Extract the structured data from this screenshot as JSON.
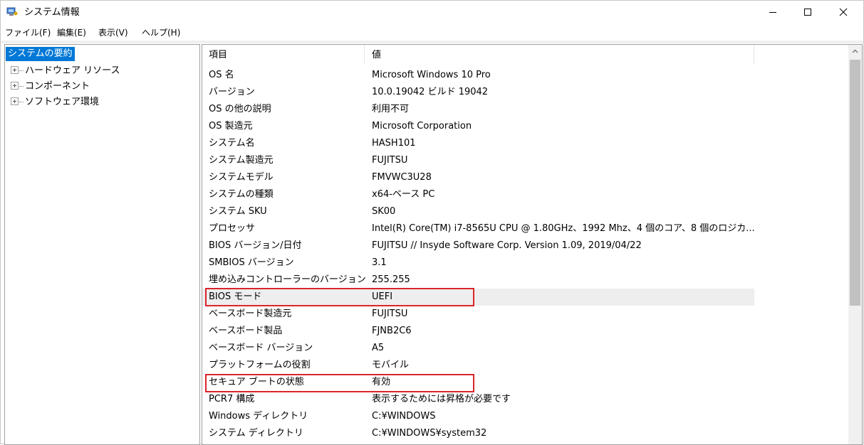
{
  "window": {
    "title": "システム情報",
    "app_icon": "system-info-icon",
    "controls": {
      "minimize": "minimize-icon",
      "maximize": "maximize-icon",
      "close": "close-icon"
    }
  },
  "menu": {
    "items": [
      {
        "label": "ファイル(F)"
      },
      {
        "label": "編集(E)"
      },
      {
        "label": "表示(V)"
      },
      {
        "label": "ヘルプ(H)"
      }
    ]
  },
  "tree": {
    "root": {
      "label": "システムの要約",
      "selected": true
    },
    "children": [
      {
        "label": "ハードウェア リソース",
        "icon": "expand-plus-icon"
      },
      {
        "label": "コンポーネント",
        "icon": "expand-plus-icon"
      },
      {
        "label": "ソフトウェア環境",
        "icon": "expand-plus-icon"
      }
    ]
  },
  "list": {
    "columns": [
      {
        "label": "項目"
      },
      {
        "label": "値"
      }
    ],
    "rows": [
      {
        "item": "OS 名",
        "value": "Microsoft Windows 10 Pro"
      },
      {
        "item": "バージョン",
        "value": "10.0.19042 ビルド 19042"
      },
      {
        "item": "OS の他の説明",
        "value": "利用不可"
      },
      {
        "item": "OS 製造元",
        "value": "Microsoft Corporation"
      },
      {
        "item": "システム名",
        "value": "HASH101"
      },
      {
        "item": "システム製造元",
        "value": "FUJITSU"
      },
      {
        "item": "システムモデル",
        "value": "FMVWC3U28"
      },
      {
        "item": "システムの種類",
        "value": "x64-ベース PC"
      },
      {
        "item": "システム SKU",
        "value": "SK00"
      },
      {
        "item": "プロセッサ",
        "value": "Intel(R) Core(TM) i7-8565U CPU @ 1.80GHz、1992 Mhz、4 個のコア、8 個のロジカ..."
      },
      {
        "item": "BIOS バージョン/日付",
        "value": "FUJITSU // Insyde Software Corp. Version 1.09, 2019/04/22"
      },
      {
        "item": "SMBIOS バージョン",
        "value": "3.1"
      },
      {
        "item": "埋め込みコントローラーのバージョン",
        "value": "255.255"
      },
      {
        "item": "BIOS モード",
        "value": "UEFI",
        "highlighted": true,
        "annotated": true
      },
      {
        "item": "ベースボード製造元",
        "value": "FUJITSU"
      },
      {
        "item": "ベースボード製品",
        "value": "FJNB2C6"
      },
      {
        "item": "ベースボード バージョン",
        "value": "A5"
      },
      {
        "item": "プラットフォームの役割",
        "value": "モバイル"
      },
      {
        "item": "セキュア ブートの状態",
        "value": "有効",
        "annotated": true
      },
      {
        "item": "PCR7 構成",
        "value": "表示するためには昇格が必要です"
      },
      {
        "item": "Windows ディレクトリ",
        "value": "C:¥WINDOWS"
      },
      {
        "item": "システム ディレクトリ",
        "value": "C:¥WINDOWS¥system32"
      }
    ]
  },
  "colors": {
    "selection": "#0078d7",
    "annotation_box": "#d9252b",
    "row_highlight": "#eeeeee",
    "scroll_thumb": "#c1c1c1"
  }
}
